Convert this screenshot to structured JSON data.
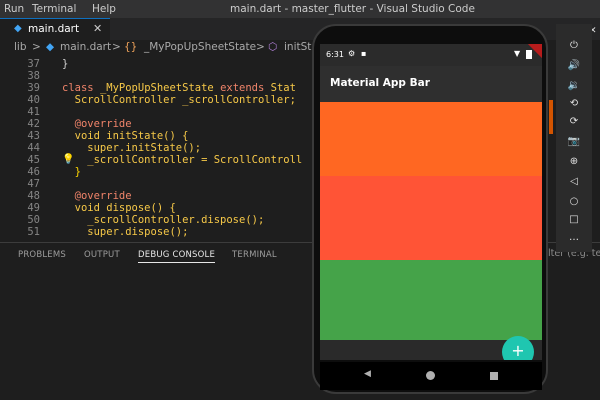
{
  "menu": {
    "items": [
      "Run",
      "Terminal",
      "Help"
    ]
  },
  "window_title": "main.dart - master_flutter - Visual Studio Code",
  "tab": {
    "label": "main.dart",
    "close": "✕"
  },
  "breadcrumb": {
    "root": "lib",
    "sep": ">",
    "file": "main.dart",
    "class_name": "_MyPopUpSheetState",
    "method": "initSt"
  },
  "editor": {
    "lines": [
      {
        "n": "37",
        "code": "}"
      },
      {
        "n": "38",
        "code": ""
      },
      {
        "n": "39",
        "kw": "class",
        "cls": "_MyPopUpSheetState",
        "kw2": "extends",
        "rest": "Stat"
      },
      {
        "n": "40",
        "code": "  ScrollController _scrollController;"
      },
      {
        "n": "41",
        "code": ""
      },
      {
        "n": "42",
        "code": "  @override"
      },
      {
        "n": "43",
        "code": "  void initState() {"
      },
      {
        "n": "44",
        "code": "    super.initState();"
      },
      {
        "n": "45",
        "code": "    _scrollController = ScrollControll"
      },
      {
        "n": "46",
        "code": "  }"
      },
      {
        "n": "47",
        "code": ""
      },
      {
        "n": "48",
        "code": "  @override"
      },
      {
        "n": "49",
        "code": "  void dispose() {"
      },
      {
        "n": "50",
        "code": "    _scrollController.dispose();"
      },
      {
        "n": "51",
        "code": "    super.dispose();"
      }
    ]
  },
  "panel": {
    "tabs": [
      "PROBLEMS",
      "OUTPUT",
      "DEBUG CONSOLE",
      "TERMINAL"
    ],
    "active_tab": "DEBUG CONSOLE",
    "filter_placeholder": "lter (e.g. te"
  },
  "emulator": {
    "status_time": "6:31",
    "app_bar_title": "Material App Bar",
    "fab_label": "+",
    "colors": {
      "orange": "#ff6722",
      "red": "#ff5436",
      "green": "#45a349",
      "fab": "#1fc6b0"
    }
  },
  "toolbar": {
    "icons": [
      "power-icon",
      "volume-up-icon",
      "volume-down-icon",
      "rotate-left-icon",
      "rotate-right-icon",
      "camera-icon",
      "zoom-icon",
      "back-icon",
      "home-icon",
      "overview-icon",
      "more-icon"
    ]
  }
}
